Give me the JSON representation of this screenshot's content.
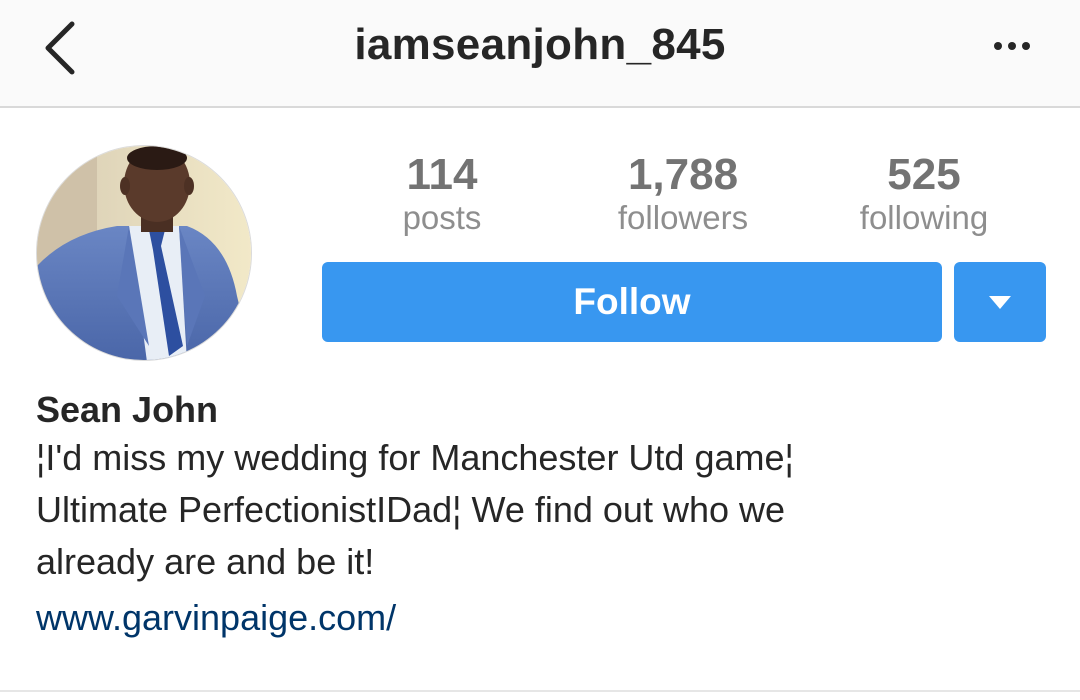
{
  "header": {
    "username": "iamseanjohn_845",
    "back_icon": "chevron-left-icon",
    "more_icon": "more-horizontal-icon"
  },
  "profile": {
    "stats": {
      "posts_count": "114",
      "posts_label": "posts",
      "followers_count": "1,788",
      "followers_label": "followers",
      "following_count": "525",
      "following_label": "following"
    },
    "follow_label": "Follow",
    "dropdown_icon": "caret-down-icon",
    "name": "Sean John",
    "bio_lines": [
      "¦I'd miss my wedding for Manchester Utd game¦",
      "Ultimate PerfectionistIDad¦ We find out who we",
      "already are and be it!"
    ],
    "website": "www.garvinpaige.com/"
  },
  "colors": {
    "accent": "#3897f0",
    "link": "#003569",
    "text": "#262626",
    "muted": "#8e8e8e"
  }
}
